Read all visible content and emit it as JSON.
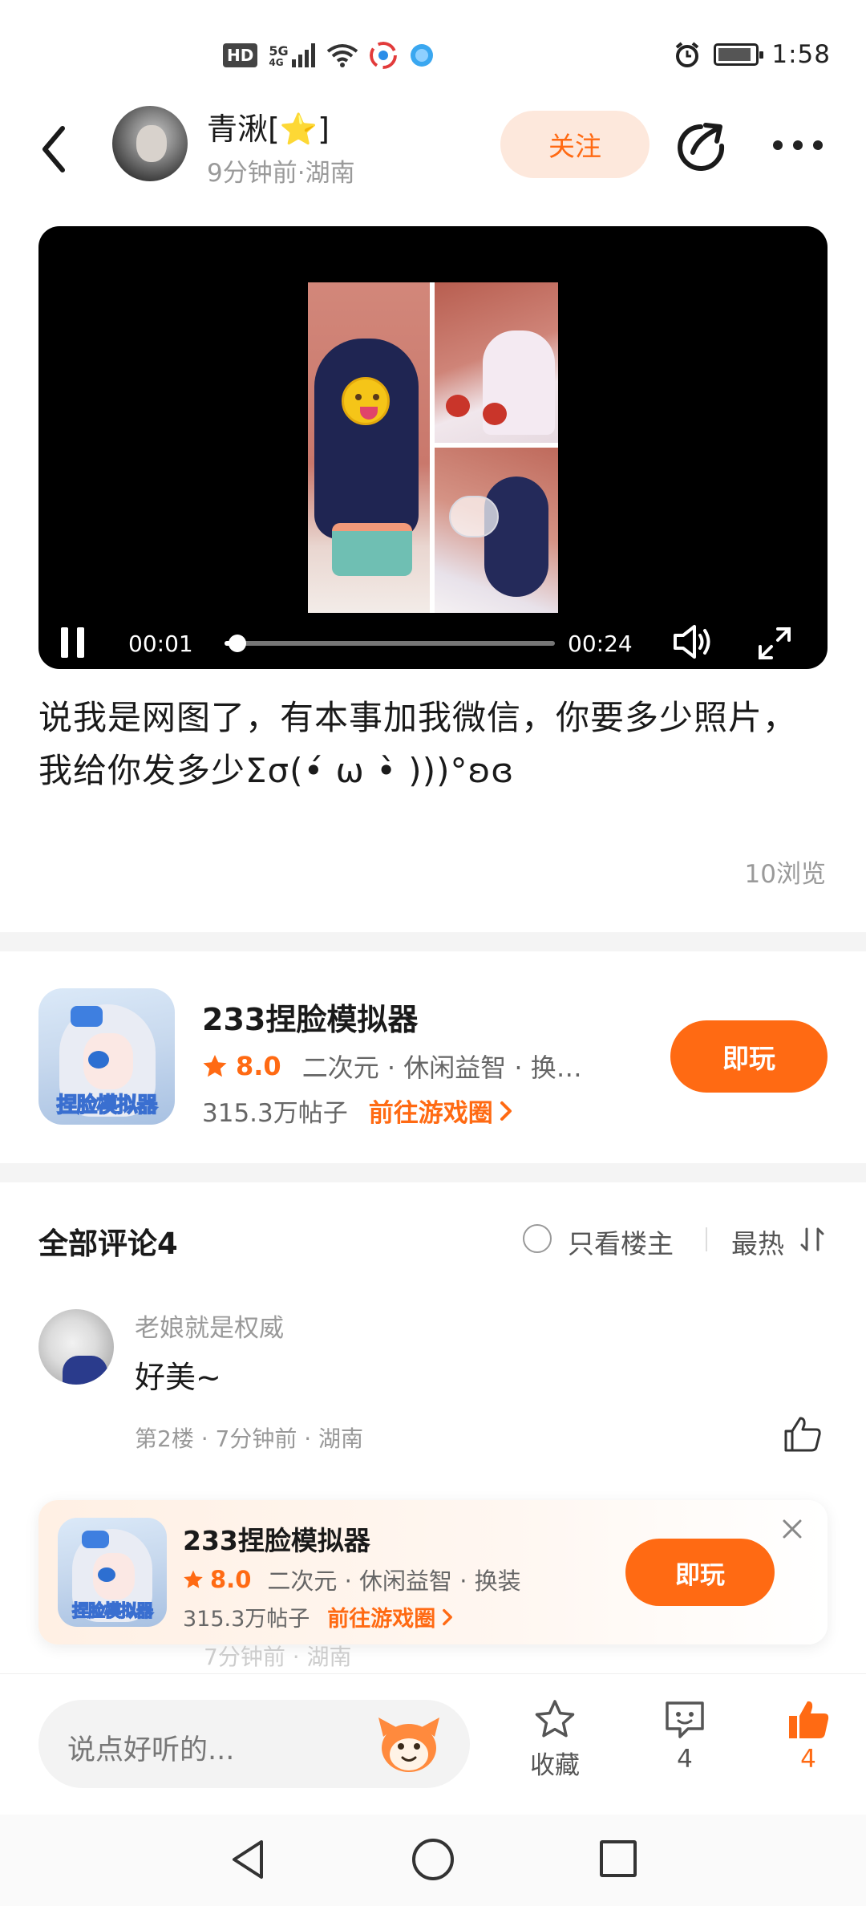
{
  "status_bar": {
    "hd": "HD",
    "network": "5G",
    "signal_sub": "4G",
    "time": "1:58"
  },
  "header": {
    "user_name": "青湫[⭐]",
    "meta": "9分钟前·湖南",
    "follow_label": "关注"
  },
  "video": {
    "current_time": "00:01",
    "duration": "00:24",
    "progress": 0.04
  },
  "post": {
    "text": "说我是网图了，有本事加我微信，你要多少照片，我给你发多少Σσ(•́ ω •̀ )))°ʚɞ",
    "views": "10浏览"
  },
  "game_card": {
    "icon_text": "捏脸模拟器",
    "title": "233捏脸模拟器",
    "rating": "8.0",
    "tags": "二次元 · 休闲益智 · 换…",
    "posts": "315.3万帖子",
    "link": "前往游戏圈",
    "play_label": "即玩"
  },
  "comments": {
    "title": "全部评论4",
    "only_host": "只看楼主",
    "sort": "最热",
    "items": [
      {
        "user": "老娘就是权威",
        "text": "好美~",
        "meta": "第2楼 · 7分钟前 · 湖南"
      }
    ]
  },
  "float_card": {
    "icon_text": "捏脸模拟器",
    "title": "233捏脸模拟器",
    "rating": "8.0",
    "tags": "二次元 · 休闲益智 · 换装",
    "posts": "315.3万帖子",
    "link": "前往游戏圈",
    "play_label": "即玩",
    "behind_meta": "7分钟前 · 湖南"
  },
  "bottom_bar": {
    "placeholder": "说点好听的...",
    "collect_label": "收藏",
    "comment_count": "4",
    "like_count": "4"
  },
  "colors": {
    "accent": "#ff6a13",
    "follow_bg": "#fde8dc"
  }
}
